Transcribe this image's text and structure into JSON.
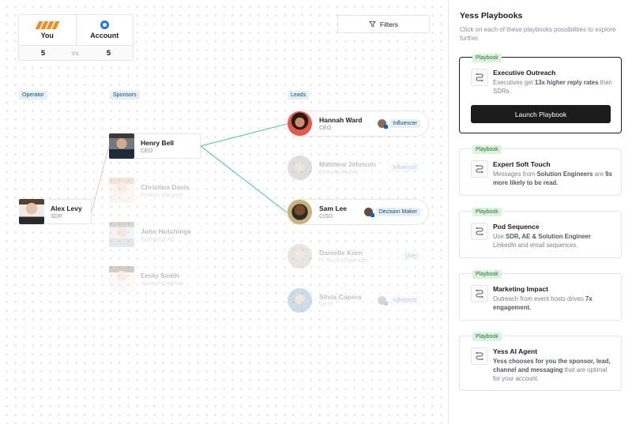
{
  "compare": {
    "you_label": "You",
    "account_label": "Account",
    "you_count": "5",
    "vs_label": "Vs.",
    "account_count": "5",
    "brand_color": "#f28b1d",
    "account_color": "#1877f2"
  },
  "filters": {
    "label": "Filters",
    "icon": "filter-icon"
  },
  "columns": {
    "operator": "Operator",
    "sponsors": "Sponsors",
    "leads": "Leads"
  },
  "operator": {
    "name": "Alex Levy",
    "role": "SDR"
  },
  "sponsors": [
    {
      "name": "Henry Bell",
      "role": "CEO"
    },
    {
      "name": "Christina Davis",
      "role": "Product Manager"
    },
    {
      "name": "John Hutchings",
      "role": "Enterprise AE"
    },
    {
      "name": "Emily Smith",
      "role": "Solution Engineer"
    }
  ],
  "leads": [
    {
      "name": "Hannah Ward",
      "role": "CEO",
      "tag": "Influencer"
    },
    {
      "name": "Matthew Johnson",
      "role": "Security Analyst",
      "tag": "Influencer"
    },
    {
      "name": "Sam Lee",
      "role": "CISO",
      "tag": "Decision Maker"
    },
    {
      "name": "Danielle Korn",
      "role": "IT Security Manager",
      "tag": "User"
    },
    {
      "name": "Silvia Capera",
      "role": "VP IT",
      "tag": "Influencer"
    }
  ],
  "sidebar": {
    "title": "Yess Playbooks",
    "subtitle": "Click on each of these playbooks possibilities to explore further.",
    "badge": "Playbook",
    "launch_label": "Launch Playbook",
    "playbooks": [
      {
        "title": "Executive Outreach",
        "desc": "Executives get <b>13x higher reply rates</b> than SDRs."
      },
      {
        "title": "Expert Soft Touch",
        "desc": "Messages from <b>Solution Engineers</b> are <b>9x more likely to be read.</b>"
      },
      {
        "title": "Pod Sequence",
        "desc": "Use <b>SDR, AE &amp; Solution Engineer</b> LinkedIn and email sequences."
      },
      {
        "title": "Marketing Impact",
        "desc": "Outreach from event hosts drives <b>7x engagement.</b>"
      },
      {
        "title": "Yess AI Agent",
        "desc": "<b>Yess chooses for you the sponsor, lead, channel and messaging</b> that are optimal for your account."
      }
    ]
  }
}
